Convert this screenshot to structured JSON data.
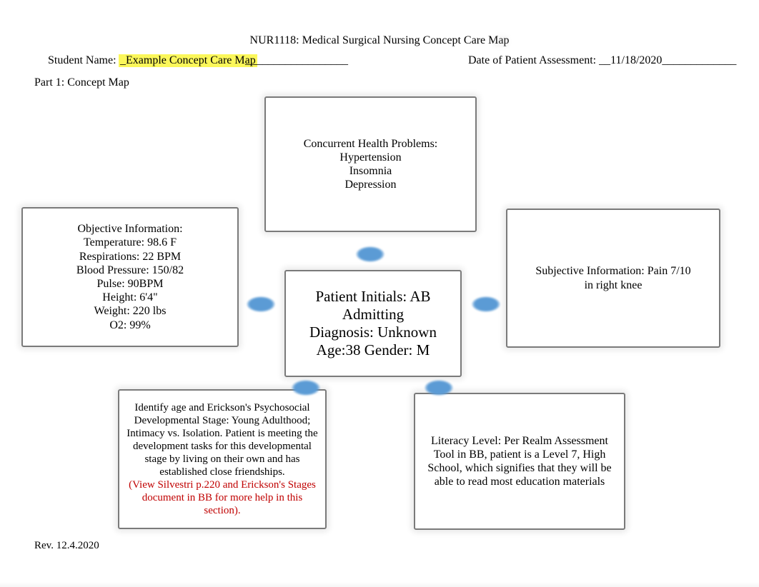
{
  "header": {
    "course_title": "NUR1118: Medical Surgical Nursing Concept Care Map",
    "student_label": "Student Name:",
    "student_value": "_Example Concept Care Map",
    "student_tail": "__________________",
    "date_label": "Date of Patient Assessment: __",
    "date_value": "11/18/2020",
    "date_tail": "_____________"
  },
  "part1": "Part 1: Concept Map",
  "rev": "Rev. 12.4.2020",
  "boxes": {
    "top": {
      "title": "Concurrent Health Problems:",
      "l1": "Hypertension",
      "l2": "Insomnia",
      "l3": "Depression"
    },
    "left": {
      "title": "Objective Information:",
      "l1": "Temperature: 98.6 F",
      "l2": "Respirations: 22 BPM",
      "l3": "Blood Pressure: 150/82",
      "l4": "Pulse: 90BPM",
      "l5": "Height: 6'4\"",
      "l6": "Weight: 220 lbs",
      "l7": "O2: 99%"
    },
    "center": {
      "l1": "Patient Initials: AB",
      "l2": "Admitting",
      "l3": "Diagnosis: Unknown",
      "l4": "Age:38 Gender: M"
    },
    "right": {
      "l1": "Subjective Information: Pain 7/10",
      "l2": "in right knee"
    },
    "bl": {
      "l1": "Identify age and Erickson's Psychosocial Developmental Stage: Young Adulthood; Intimacy vs. Isolation. Patient is meeting the development tasks for this developmental stage by living on their own and has established close friendships.",
      "l2": "(View Silvestri p.220 and Erickson's Stages document in BB for more help in this section)."
    },
    "br": {
      "l1": "Literacy Level: Per Realm Assessment Tool in BB, patient is a Level 7, High School, which signifies that they will be able to read most education materials"
    }
  }
}
